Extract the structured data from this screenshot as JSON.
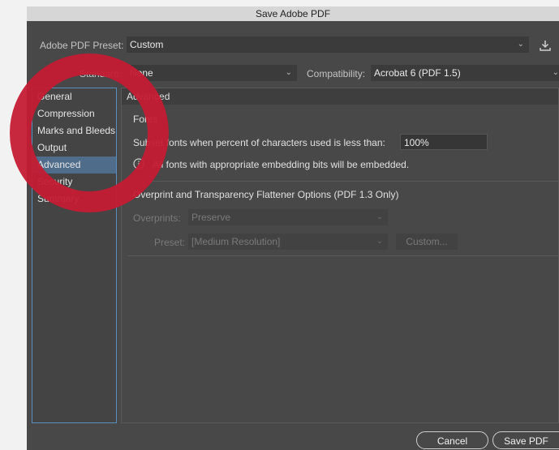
{
  "window": {
    "title": "Save Adobe PDF"
  },
  "preset": {
    "label": "Adobe PDF Preset:",
    "value": "Custom"
  },
  "standard": {
    "label": "Standard:",
    "value": "None"
  },
  "compatibility": {
    "label": "Compatibility:",
    "value": "Acrobat 6 (PDF 1.5)"
  },
  "sidebar": {
    "items": [
      {
        "label": "General"
      },
      {
        "label": "Compression"
      },
      {
        "label": "Marks and Bleeds"
      },
      {
        "label": "Output"
      },
      {
        "label": "Advanced"
      },
      {
        "label": "Security"
      },
      {
        "label": "Summary"
      }
    ]
  },
  "panel": {
    "section_title": "Advanced",
    "fonts_header": "Fonts",
    "subset_label": "Subset fonts when percent of characters used is less than:",
    "subset_value": "100%",
    "info_text": "All fonts with appropriate embedding bits will be embedded.",
    "overprint_header": "Overprint and Transparency Flattener Options (PDF 1.3 Only)",
    "overprints_label": "Overprints:",
    "overprints_value": "Preserve",
    "preset_label": "Preset:",
    "preset_value": "[Medium Resolution]",
    "custom_button": "Custom..."
  },
  "buttons": {
    "cancel": "Cancel",
    "save": "Save PDF"
  },
  "colors": {
    "annotation_circle": "#c41c34",
    "active_item": "#4f6c8b",
    "dialog_bg": "#484848"
  }
}
